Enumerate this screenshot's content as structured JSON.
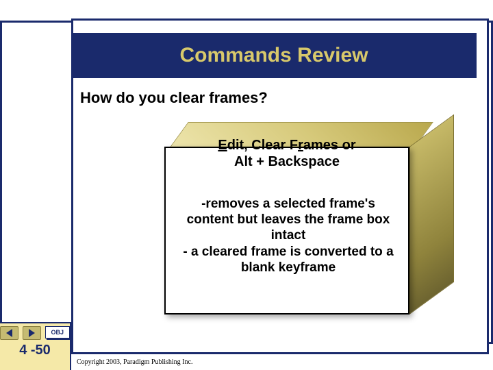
{
  "title": "Commands Review",
  "question": "How do you clear frames?",
  "answer": {
    "line1a": "E",
    "line1b": "dit, Clear F",
    "line1c": "r",
    "line1d": "ames or",
    "line2": "Alt + Backspace",
    "desc": "-removes a selected frame's content but leaves the frame box intact\n- a cleared frame is converted to a blank keyframe"
  },
  "nav": {
    "obj_label": "OBJ",
    "slide_number": "4 -50"
  },
  "copyright": "Copyright 2003, Paradigm Publishing Inc."
}
